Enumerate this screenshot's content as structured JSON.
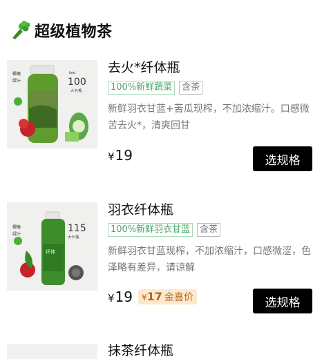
{
  "section": {
    "title": "超级植物茶",
    "icon": "celery-icon"
  },
  "products": [
    {
      "name": "去火*纤体瓶",
      "tags": [
        "100%新鲜蔬菜",
        "含茶"
      ],
      "description": "新鲜羽衣甘蓝+苦瓜现榨，不加浓缩汁。口感微苦去火*，清爽回甘",
      "currency": "¥",
      "price": "19",
      "button": "选规格",
      "image": {
        "label_number": "100",
        "label_unit": "大卡/瓶"
      }
    },
    {
      "name": "羽衣纤体瓶",
      "tags": [
        "100%新鲜羽衣甘蓝",
        "含茶"
      ],
      "description": "新鲜羽衣甘蓝现榨，不加浓缩汁，口感微涩，色泽略有差异，请谅解",
      "currency": "¥",
      "price": "19",
      "deal": {
        "currency": "¥",
        "amount": "17",
        "label": "金喜价"
      },
      "button": "选规格",
      "image": {
        "label_number": "115",
        "label_unit": "大卡/瓶"
      }
    },
    {
      "name": "抹茶纤体瓶"
    }
  ],
  "colors": {
    "tag_green": "#4aa968",
    "button_bg": "#000000",
    "deal_bg": "#fde8cc",
    "deal_text": "#b5661c"
  }
}
